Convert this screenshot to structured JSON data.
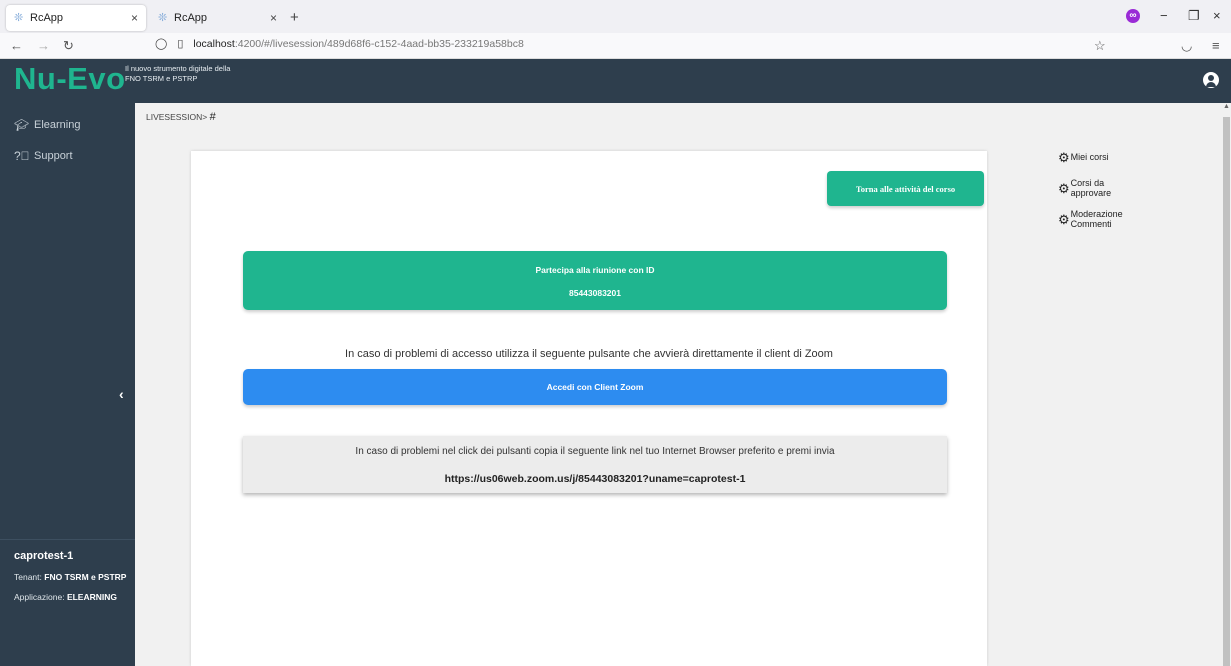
{
  "browser": {
    "tabs": [
      {
        "label": "RcApp",
        "active": true
      },
      {
        "label": "RcApp",
        "active": false
      }
    ],
    "url_host": "localhost",
    "url_path": ":4200/#/livesession/489d68f6-c152-4aad-bb35-233219a58bc8"
  },
  "header": {
    "logo": "Nu-Evo",
    "tagline": "Il nuovo strumento digitale della FNO TSRM e PSTRP"
  },
  "sidebar": {
    "items": [
      {
        "label": "Elearning",
        "icon": "graduation-cap-icon"
      },
      {
        "label": "Support",
        "icon": "question-circle-icon"
      }
    ],
    "collapse_glyph": "‹",
    "user": {
      "name": "caprotest-1",
      "tenant_label": "Tenant:",
      "tenant_value": "FNO TSRM e PSTRP",
      "app_label": "Applicazione:",
      "app_value": "ELEARNING"
    }
  },
  "breadcrumb": {
    "path": "LIVESESSION>",
    "hash": "#"
  },
  "main": {
    "back_button": "Torna alle attività del corso",
    "join_title": "Partecipa alla riunione con ID",
    "meeting_id": "85443083201",
    "help_text": "In caso di problemi di accesso utilizza il seguente pulsante che avvierà direttamente il client di Zoom",
    "zoom_button": "Accedi con Client Zoom",
    "link_help": "In caso di problemi nel click dei pulsanti copia il seguente link nel tuo Internet Browser preferito e premi invia",
    "link_url": "https://us06web.zoom.us/j/85443083201?uname=caprotest-1"
  },
  "right_menu": {
    "items": [
      {
        "line1": "Miei corsi",
        "line2": ""
      },
      {
        "line1": "Corsi da",
        "line2": "approvare"
      },
      {
        "line1": "Moderazione",
        "line2": "Commenti"
      }
    ]
  },
  "colors": {
    "primary_green": "#1fb58f",
    "dark_nav": "#2e3e4d",
    "zoom_blue": "#2d8cf0"
  }
}
